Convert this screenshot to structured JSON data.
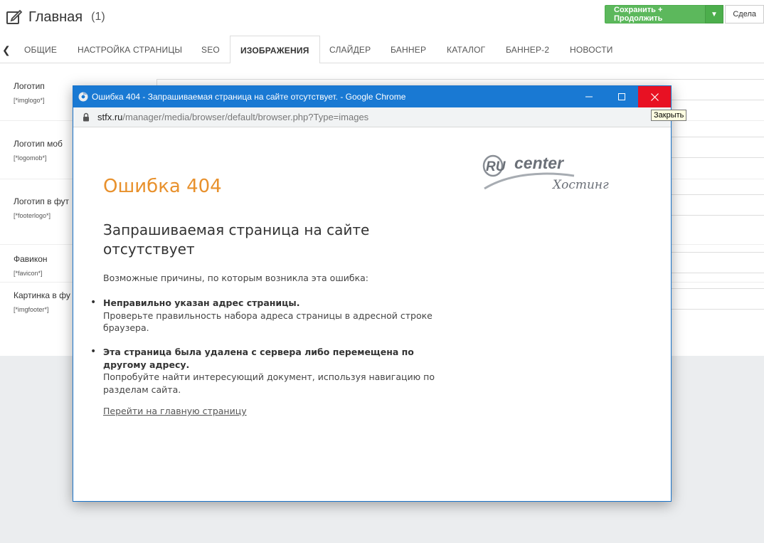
{
  "header": {
    "title": "Главная",
    "count": "(1)",
    "save_button": "Сохранить + Продолжить",
    "next_button": "Сдела"
  },
  "tabs": [
    {
      "label": "ОБЩИЕ"
    },
    {
      "label": "НАСТРОЙКА СТРАНИЦЫ"
    },
    {
      "label": "SEO"
    },
    {
      "label": "ИЗОБРАЖЕНИЯ",
      "active": true
    },
    {
      "label": "СЛАЙДЕР"
    },
    {
      "label": "БАННЕР"
    },
    {
      "label": "КАТАЛОГ"
    },
    {
      "label": "БАННЕР-2"
    },
    {
      "label": "НОВОСТИ"
    }
  ],
  "fields": [
    {
      "label": "Логотип",
      "tag": "[*imglogo*]"
    },
    {
      "label": "Логотип моб",
      "tag": "[*logomob*]"
    },
    {
      "label": "Логотип в фут",
      "tag": "[*footerlogo*]"
    },
    {
      "label": "Фавикон",
      "tag": "[*favicon*]"
    },
    {
      "label": "Картинка в фу",
      "tag": "[*imgfooter*]"
    }
  ],
  "popup": {
    "window_title": "Ошибка 404 - Запрашиваемая страница на сайте отсутствует. - Google Chrome",
    "url_host": "stfx.ru",
    "url_path": "/manager/media/browser/default/browser.php?Type=images",
    "close_tooltip": "Закрыть",
    "error_code": "Ошибка 404",
    "heading": "Запрашиваемая страница на сайте отсутствует",
    "intro": "Возможные причины, по которым возникла эта ошибка:",
    "reasons": [
      {
        "title": "Неправильно указан адрес страницы.",
        "text": "Проверьте правильность набора адреса страницы в адресной строке браузера."
      },
      {
        "title": "Эта страница была удалена с сервера либо перемещена по другому адресу.",
        "text": "Попробуйте найти интересующий документ, используя навигацию по разделам сайта."
      }
    ],
    "home_link": "Перейти на главную страницу",
    "logo": {
      "brand": "RU",
      "word": "center",
      "sub": "Хостинг"
    }
  },
  "colors": {
    "accent_orange": "#e8912d",
    "titlebar_blue": "#1979d3",
    "close_red": "#e81123",
    "save_green": "#5cb85c"
  }
}
